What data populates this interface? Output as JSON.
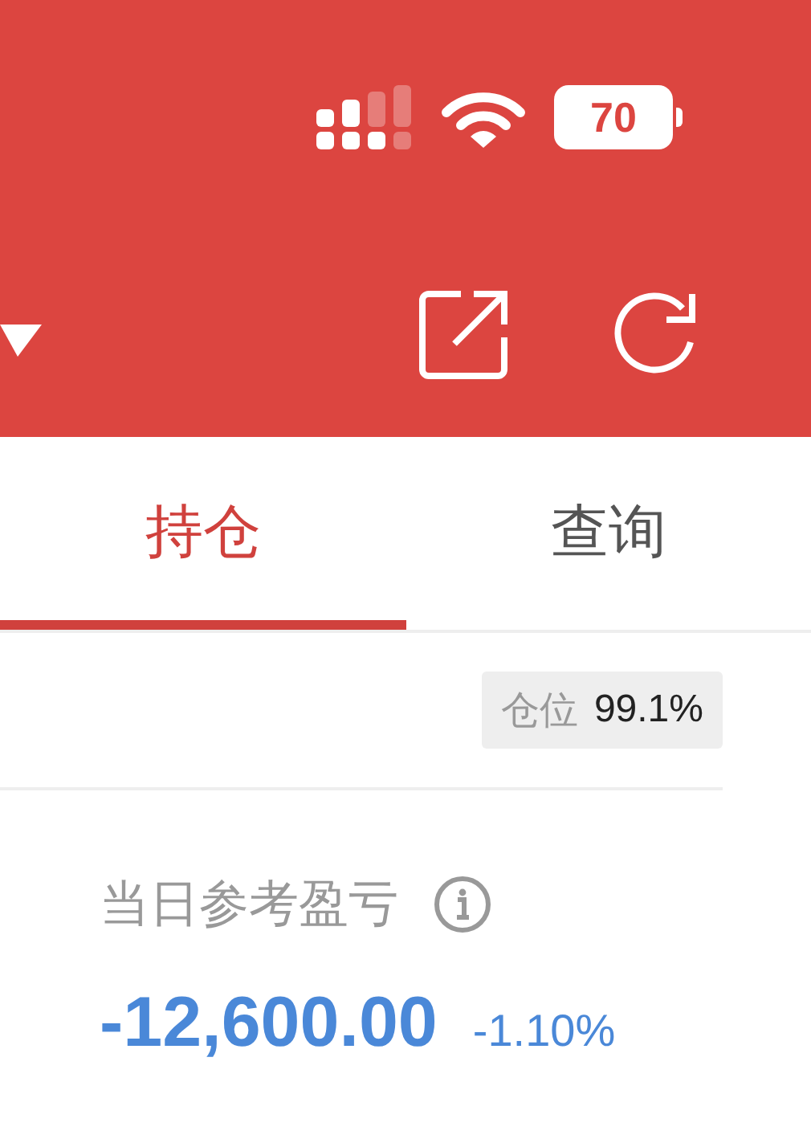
{
  "status_bar": {
    "battery": "70"
  },
  "tabs": [
    {
      "label": "持仓",
      "selected": true
    },
    {
      "label": "查询",
      "selected": false
    }
  ],
  "position": {
    "label": "仓位",
    "value": "99.1%"
  },
  "pnl": {
    "label": "当日参考盈亏",
    "value": "-12,600.00",
    "percent": "-1.10%"
  }
}
